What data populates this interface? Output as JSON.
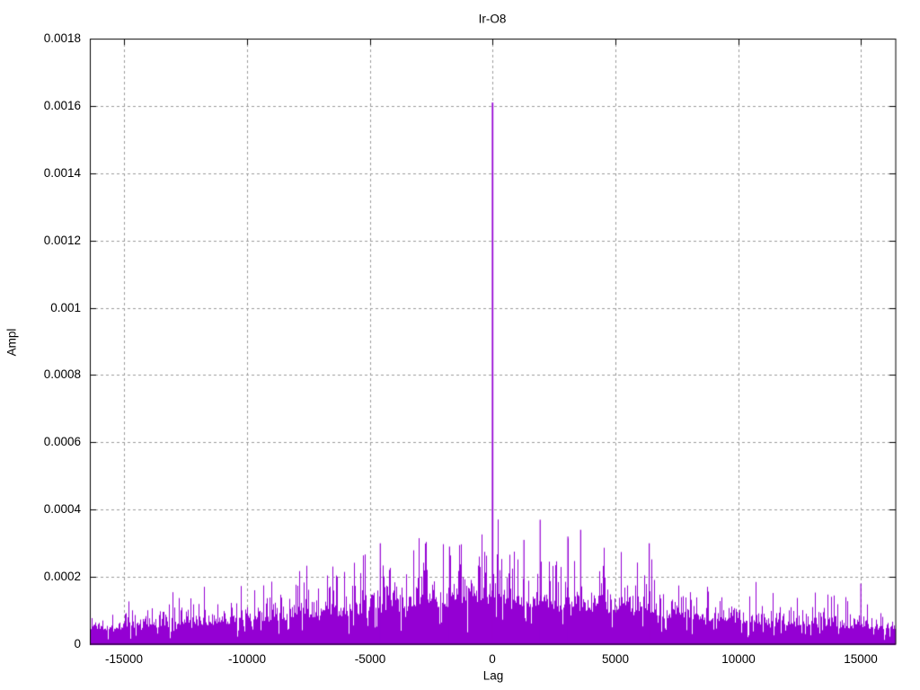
{
  "chart_data": {
    "type": "bar",
    "style": "impulses",
    "title": "Ir-O8",
    "xlabel": "Lag",
    "ylabel": "Ampl",
    "xlim": [
      -16400,
      16420
    ],
    "ylim": [
      0,
      0.0018
    ],
    "grid": true,
    "legend": "none",
    "series_color": "#9400d3",
    "grid_color": "#9b9b9b",
    "border_color": "#000000",
    "background_color": "#ffffff",
    "xticks": [
      {
        "value": -15000,
        "label": "-15000"
      },
      {
        "value": -10000,
        "label": "-10000"
      },
      {
        "value": -5000,
        "label": "-5000"
      },
      {
        "value": 0,
        "label": "0"
      },
      {
        "value": 5000,
        "label": "5000"
      },
      {
        "value": 10000,
        "label": "10000"
      },
      {
        "value": 15000,
        "label": "15000"
      }
    ],
    "yticks": [
      {
        "value": 0,
        "label": "0"
      },
      {
        "value": 0.0002,
        "label": "0.0002"
      },
      {
        "value": 0.0004,
        "label": "0.0004"
      },
      {
        "value": 0.0006,
        "label": "0.0006"
      },
      {
        "value": 0.0008,
        "label": "0.0008"
      },
      {
        "value": 0.001,
        "label": "0.001"
      },
      {
        "value": 0.0012,
        "label": "0.0012"
      },
      {
        "value": 0.0014,
        "label": "0.0014"
      },
      {
        "value": 0.0016,
        "label": "0.0016"
      },
      {
        "value": 0.0018,
        "label": "0.0018"
      }
    ],
    "main_peak": {
      "lag": 0,
      "ampl": 0.00161
    },
    "notable_peaks": [
      {
        "lag": -4570,
        "ampl": 0.0003
      },
      {
        "lag": -1750,
        "ampl": 0.00029
      },
      {
        "lag": 1280,
        "ampl": 0.00031
      },
      {
        "lag": 1940,
        "ampl": 0.00037
      },
      {
        "lag": 3070,
        "ampl": 0.00032
      },
      {
        "lag": 3590,
        "ampl": 0.00034
      },
      {
        "lag": 6380,
        "ampl": 0.0003
      },
      {
        "lag": 15000,
        "ampl": 0.00018
      }
    ],
    "noise": {
      "description": "triangular noise envelope rising from edges to center",
      "seed": 1337,
      "half_width": 16400,
      "edge_ampl": 5e-05,
      "center_boost": 0.0001,
      "shape": 1.35,
      "f_min": 0.8,
      "f_scale": 0.45,
      "f_max": 2.5,
      "deep_dip_prob": 0.02,
      "deep_dip_factor": 0.3,
      "dip_prob": 0.08,
      "dip_factor": 0.55
    }
  }
}
